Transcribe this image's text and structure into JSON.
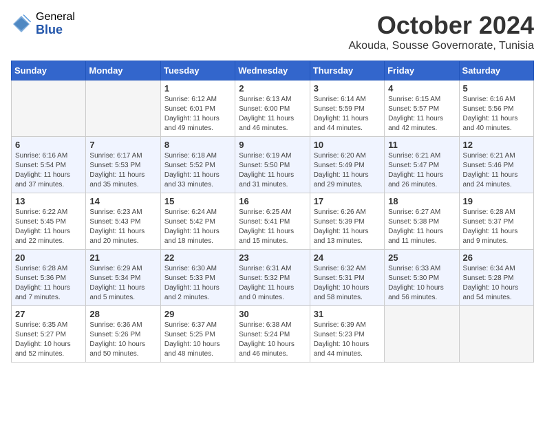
{
  "logo": {
    "general": "General",
    "blue": "Blue"
  },
  "title": "October 2024",
  "location": "Akouda, Sousse Governorate, Tunisia",
  "weekdays": [
    "Sunday",
    "Monday",
    "Tuesday",
    "Wednesday",
    "Thursday",
    "Friday",
    "Saturday"
  ],
  "weeks": [
    [
      {
        "day": "",
        "info": ""
      },
      {
        "day": "",
        "info": ""
      },
      {
        "day": "1",
        "info": "Sunrise: 6:12 AM\nSunset: 6:01 PM\nDaylight: 11 hours and 49 minutes."
      },
      {
        "day": "2",
        "info": "Sunrise: 6:13 AM\nSunset: 6:00 PM\nDaylight: 11 hours and 46 minutes."
      },
      {
        "day": "3",
        "info": "Sunrise: 6:14 AM\nSunset: 5:59 PM\nDaylight: 11 hours and 44 minutes."
      },
      {
        "day": "4",
        "info": "Sunrise: 6:15 AM\nSunset: 5:57 PM\nDaylight: 11 hours and 42 minutes."
      },
      {
        "day": "5",
        "info": "Sunrise: 6:16 AM\nSunset: 5:56 PM\nDaylight: 11 hours and 40 minutes."
      }
    ],
    [
      {
        "day": "6",
        "info": "Sunrise: 6:16 AM\nSunset: 5:54 PM\nDaylight: 11 hours and 37 minutes."
      },
      {
        "day": "7",
        "info": "Sunrise: 6:17 AM\nSunset: 5:53 PM\nDaylight: 11 hours and 35 minutes."
      },
      {
        "day": "8",
        "info": "Sunrise: 6:18 AM\nSunset: 5:52 PM\nDaylight: 11 hours and 33 minutes."
      },
      {
        "day": "9",
        "info": "Sunrise: 6:19 AM\nSunset: 5:50 PM\nDaylight: 11 hours and 31 minutes."
      },
      {
        "day": "10",
        "info": "Sunrise: 6:20 AM\nSunset: 5:49 PM\nDaylight: 11 hours and 29 minutes."
      },
      {
        "day": "11",
        "info": "Sunrise: 6:21 AM\nSunset: 5:47 PM\nDaylight: 11 hours and 26 minutes."
      },
      {
        "day": "12",
        "info": "Sunrise: 6:21 AM\nSunset: 5:46 PM\nDaylight: 11 hours and 24 minutes."
      }
    ],
    [
      {
        "day": "13",
        "info": "Sunrise: 6:22 AM\nSunset: 5:45 PM\nDaylight: 11 hours and 22 minutes."
      },
      {
        "day": "14",
        "info": "Sunrise: 6:23 AM\nSunset: 5:43 PM\nDaylight: 11 hours and 20 minutes."
      },
      {
        "day": "15",
        "info": "Sunrise: 6:24 AM\nSunset: 5:42 PM\nDaylight: 11 hours and 18 minutes."
      },
      {
        "day": "16",
        "info": "Sunrise: 6:25 AM\nSunset: 5:41 PM\nDaylight: 11 hours and 15 minutes."
      },
      {
        "day": "17",
        "info": "Sunrise: 6:26 AM\nSunset: 5:39 PM\nDaylight: 11 hours and 13 minutes."
      },
      {
        "day": "18",
        "info": "Sunrise: 6:27 AM\nSunset: 5:38 PM\nDaylight: 11 hours and 11 minutes."
      },
      {
        "day": "19",
        "info": "Sunrise: 6:28 AM\nSunset: 5:37 PM\nDaylight: 11 hours and 9 minutes."
      }
    ],
    [
      {
        "day": "20",
        "info": "Sunrise: 6:28 AM\nSunset: 5:36 PM\nDaylight: 11 hours and 7 minutes."
      },
      {
        "day": "21",
        "info": "Sunrise: 6:29 AM\nSunset: 5:34 PM\nDaylight: 11 hours and 5 minutes."
      },
      {
        "day": "22",
        "info": "Sunrise: 6:30 AM\nSunset: 5:33 PM\nDaylight: 11 hours and 2 minutes."
      },
      {
        "day": "23",
        "info": "Sunrise: 6:31 AM\nSunset: 5:32 PM\nDaylight: 11 hours and 0 minutes."
      },
      {
        "day": "24",
        "info": "Sunrise: 6:32 AM\nSunset: 5:31 PM\nDaylight: 10 hours and 58 minutes."
      },
      {
        "day": "25",
        "info": "Sunrise: 6:33 AM\nSunset: 5:30 PM\nDaylight: 10 hours and 56 minutes."
      },
      {
        "day": "26",
        "info": "Sunrise: 6:34 AM\nSunset: 5:28 PM\nDaylight: 10 hours and 54 minutes."
      }
    ],
    [
      {
        "day": "27",
        "info": "Sunrise: 6:35 AM\nSunset: 5:27 PM\nDaylight: 10 hours and 52 minutes."
      },
      {
        "day": "28",
        "info": "Sunrise: 6:36 AM\nSunset: 5:26 PM\nDaylight: 10 hours and 50 minutes."
      },
      {
        "day": "29",
        "info": "Sunrise: 6:37 AM\nSunset: 5:25 PM\nDaylight: 10 hours and 48 minutes."
      },
      {
        "day": "30",
        "info": "Sunrise: 6:38 AM\nSunset: 5:24 PM\nDaylight: 10 hours and 46 minutes."
      },
      {
        "day": "31",
        "info": "Sunrise: 6:39 AM\nSunset: 5:23 PM\nDaylight: 10 hours and 44 minutes."
      },
      {
        "day": "",
        "info": ""
      },
      {
        "day": "",
        "info": ""
      }
    ]
  ]
}
